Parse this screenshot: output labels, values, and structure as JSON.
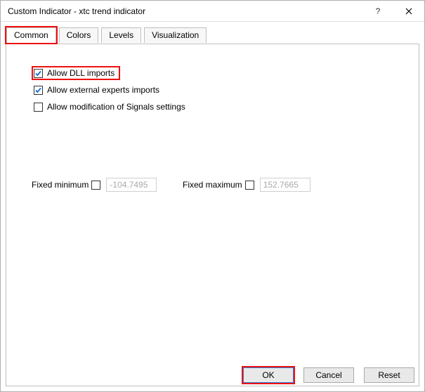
{
  "window": {
    "title": "Custom Indicator - xtc trend indicator"
  },
  "tabs": {
    "common": "Common",
    "colors": "Colors",
    "levels": "Levels",
    "visualization": "Visualization"
  },
  "checks": {
    "dll": "Allow DLL imports",
    "ext": "Allow external experts imports",
    "sig": "Allow modification of Signals settings"
  },
  "fixed": {
    "min_label": "Fixed minimum",
    "min_value": "-104.7495",
    "max_label": "Fixed maximum",
    "max_value": "152.7665"
  },
  "buttons": {
    "ok": "OK",
    "cancel": "Cancel",
    "reset": "Reset"
  }
}
